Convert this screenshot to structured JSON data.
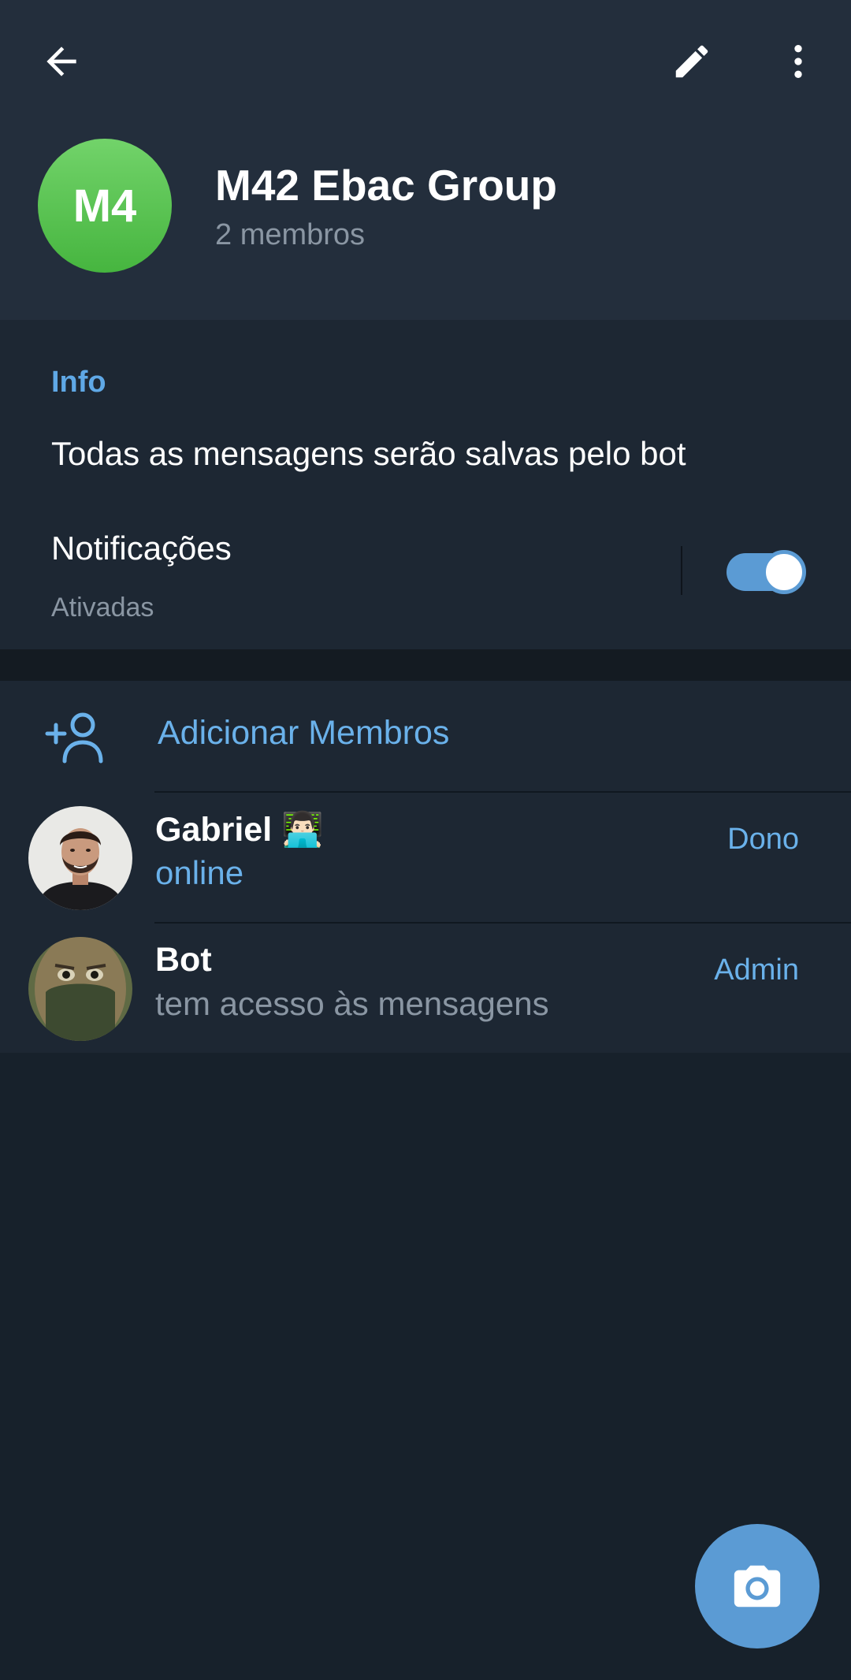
{
  "header": {
    "back_icon": "arrow-left-icon",
    "edit_icon": "pencil-icon",
    "more_icon": "more-vertical-icon",
    "avatar_initials": "M4",
    "avatar_color": "#56c24c",
    "group_name": "M42 Ebac Group",
    "member_count": "2 membros"
  },
  "info": {
    "title": "Info",
    "description": "Todas as mensagens serão salvas pelo bot",
    "notifications_label": "Notificações",
    "notifications_status": "Ativadas",
    "notifications_enabled": true
  },
  "members": {
    "add_label": "Adicionar Membros",
    "list": [
      {
        "name": "Gabriel",
        "emoji": "👨🏻‍💻",
        "status": "online",
        "status_color": "#6ab1ea",
        "role": "Dono"
      },
      {
        "name": "Bot",
        "emoji": "",
        "status": "tem acesso às mensagens",
        "status_color": "#8a96a3",
        "role": "Admin"
      }
    ]
  },
  "fab": {
    "icon": "camera-icon"
  },
  "colors": {
    "background": "#17212b",
    "header": "#232e3c",
    "section": "#1d2733",
    "accent": "#5b9bd4"
  }
}
